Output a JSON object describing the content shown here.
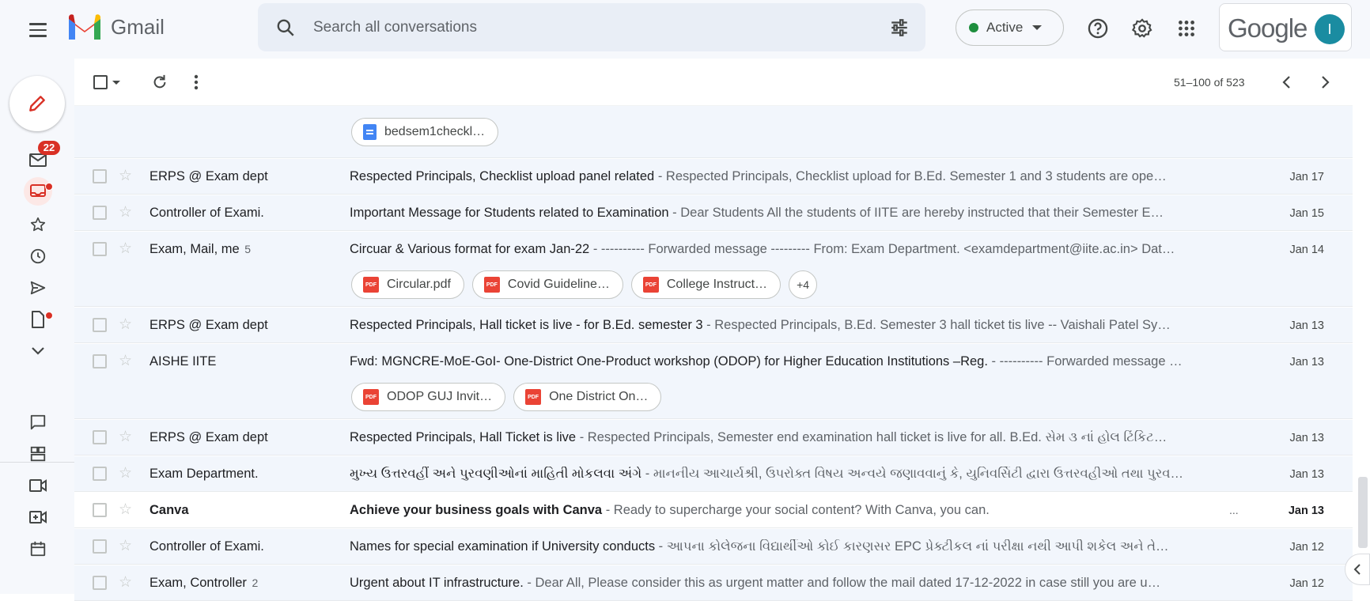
{
  "app": {
    "name": "Gmail"
  },
  "search": {
    "placeholder": "Search all conversations"
  },
  "status": {
    "label": "Active",
    "color": "#1e8e3e"
  },
  "account": {
    "brand": "Google",
    "avatar_letter": "I",
    "avatar_color": "#1a8ca1"
  },
  "sidebar": {
    "inbox_badge": "22"
  },
  "toolbar": {
    "paging": "51–100 of 523"
  },
  "partial_row": {
    "attachment": "bedsem1checkl…"
  },
  "emails": [
    {
      "sender": "ERPS @ Exam dept",
      "count": "",
      "subject": "Respected Principals, Checklist upload panel related",
      "snippet": " - Respected Principals, Checklist upload for B.Ed. Semester 1 and 3 students are ope…",
      "date": "Jan 17",
      "unread": false,
      "attachments": []
    },
    {
      "sender": "Controller of Exami.",
      "count": "",
      "subject": "Important Message for Students related to Examination",
      "snippet": " - Dear Students All the students of IITE are hereby instructed that their Semester E…",
      "date": "Jan 15",
      "unread": false,
      "attachments": []
    },
    {
      "sender": "Exam, Mail, me",
      "count": "5",
      "subject": "Circuar & Various format for exam Jan-22",
      "snippet": " - ---------- Forwarded message --------- From: Exam Department. <examdepartment@iite.ac.in> Dat…",
      "date": "Jan 14",
      "unread": false,
      "attachments": [
        "Circular.pdf",
        "Covid Guideline…",
        "College Instruct…"
      ],
      "more": "+4"
    },
    {
      "sender": "ERPS @ Exam dept",
      "count": "",
      "subject": "Respected Principals, Hall ticket is live - for B.Ed. semester 3",
      "snippet": " - Respected Principals, B.Ed. Semester 3 hall ticket tis live -- Vaishali Patel Sy…",
      "date": "Jan 13",
      "unread": false,
      "attachments": []
    },
    {
      "sender": "AISHE IITE",
      "count": "",
      "subject": "Fwd: MGNCRE-MoE-GoI- One-District One-Product workshop (ODOP) for Higher Education Institutions –Reg.",
      "snippet": " - ---------- Forwarded message …",
      "date": "Jan 13",
      "unread": false,
      "attachments": [
        "ODOP GUJ Invit…",
        "One District On…"
      ]
    },
    {
      "sender": "ERPS @ Exam dept",
      "count": "",
      "subject": "Respected Principals, Hall Ticket is live",
      "snippet": " - Respected Principals, Semester end examination hall ticket is live for all. B.Ed. સેમ ૩ નાં હોલ ટિંકિટ…",
      "date": "Jan 13",
      "unread": false,
      "attachments": []
    },
    {
      "sender": "Exam Department.",
      "count": "",
      "subject": "મુખ્ય ઉત્તરવહીં અને પુરવણીઓનાં માહિતી મોકલવા અંગે",
      "snippet": " - માનનીય આચાર્યશ્રી, ઉપરોક્ત વિષય અન્વયે જણાવવાનું કે, યુનિવર્સિટી દ્વારા ઉત્તરવહીઓ તથા પુરવ…",
      "date": "Jan 13",
      "unread": false,
      "attachments": []
    },
    {
      "sender": "Canva",
      "count": "",
      "subject": "Achieve your business goals with Canva",
      "snippet": " - Ready to supercharge your social content? With Canva, you can.",
      "date": "Jan 13",
      "unread": true,
      "attachments": [],
      "trailing": "..."
    },
    {
      "sender": "Controller of Exami.",
      "count": "",
      "subject": "Names for special examination if University conducts",
      "snippet": " - આપના કોલેજના વિદ્યાર્થીઓ કોઈ કારણસર EPC પ્રેક્ટીકલ નાં પરીક્ષા નથી આપી શકેલ અને તે…",
      "date": "Jan 12",
      "unread": false,
      "attachments": []
    },
    {
      "sender": "Exam, Controller",
      "count": "2",
      "subject": "Urgent about IT infrastructure.",
      "snippet": " - Dear All, Please consider this as urgent matter and follow the mail dated 17-12-2022 in case still you are u…",
      "date": "Jan 12",
      "unread": false,
      "attachments": []
    }
  ]
}
